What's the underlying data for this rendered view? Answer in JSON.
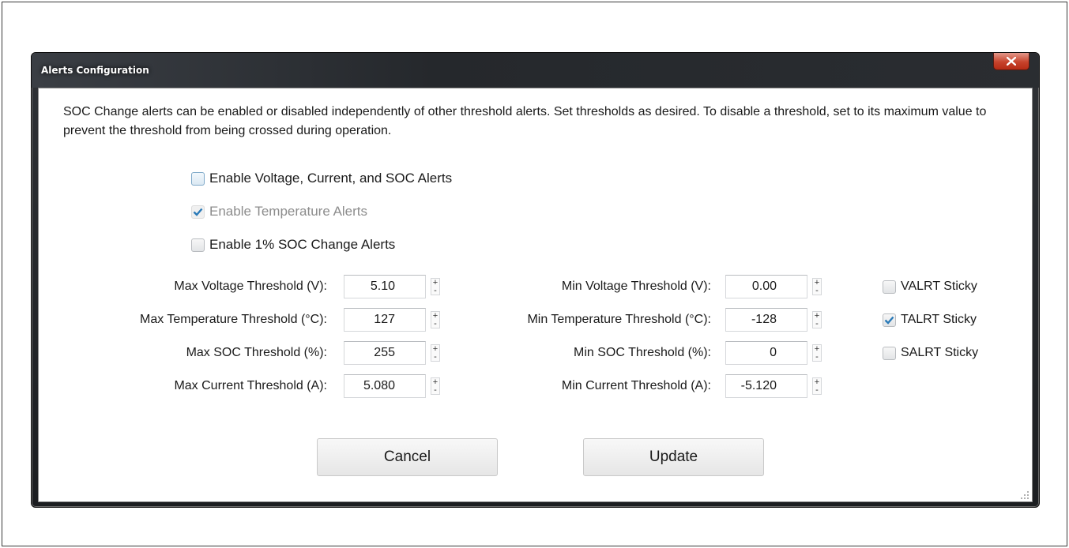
{
  "window": {
    "title": "Alerts Configuration"
  },
  "description": "SOC Change alerts can be enabled or disabled independently of other threshold alerts. Set thresholds as desired. To disable a threshold, set to its maximum value to prevent the threshold from being crossed during operation.",
  "checkboxes": {
    "voltage_current_soc": {
      "label": "Enable Voltage, Current, and SOC Alerts",
      "checked": false
    },
    "temperature": {
      "label": "Enable Temperature Alerts",
      "checked": true,
      "disabled": true
    },
    "soc_change": {
      "label": "Enable 1% SOC Change Alerts",
      "checked": false
    }
  },
  "thresholds": {
    "max_voltage": {
      "label": "Max Voltage Threshold (V):",
      "value": "5.10"
    },
    "max_temperature": {
      "label": "Max Temperature Threshold (°C):",
      "value": "127"
    },
    "max_soc": {
      "label": "Max SOC Threshold (%):",
      "value": "255"
    },
    "max_current": {
      "label": "Max Current Threshold (A):",
      "value": "5.080"
    },
    "min_voltage": {
      "label": "Min Voltage Threshold (V):",
      "value": "0.00"
    },
    "min_temperature": {
      "label": "Min Temperature Threshold (°C):",
      "value": "-128"
    },
    "min_soc": {
      "label": "Min SOC Threshold (%):",
      "value": "0"
    },
    "min_current": {
      "label": "Min Current Threshold (A):",
      "value": "-5.120"
    }
  },
  "sticky": {
    "valrt": {
      "label": "VALRT Sticky",
      "checked": false
    },
    "talrt": {
      "label": "TALRT Sticky",
      "checked": true
    },
    "salrt": {
      "label": "SALRT Sticky",
      "checked": false
    }
  },
  "spinner": {
    "up": "+",
    "down": "-"
  },
  "buttons": {
    "cancel": "Cancel",
    "update": "Update"
  },
  "colors": {
    "check_mark": "#2a7ab8",
    "close_button": "#c7432c"
  }
}
